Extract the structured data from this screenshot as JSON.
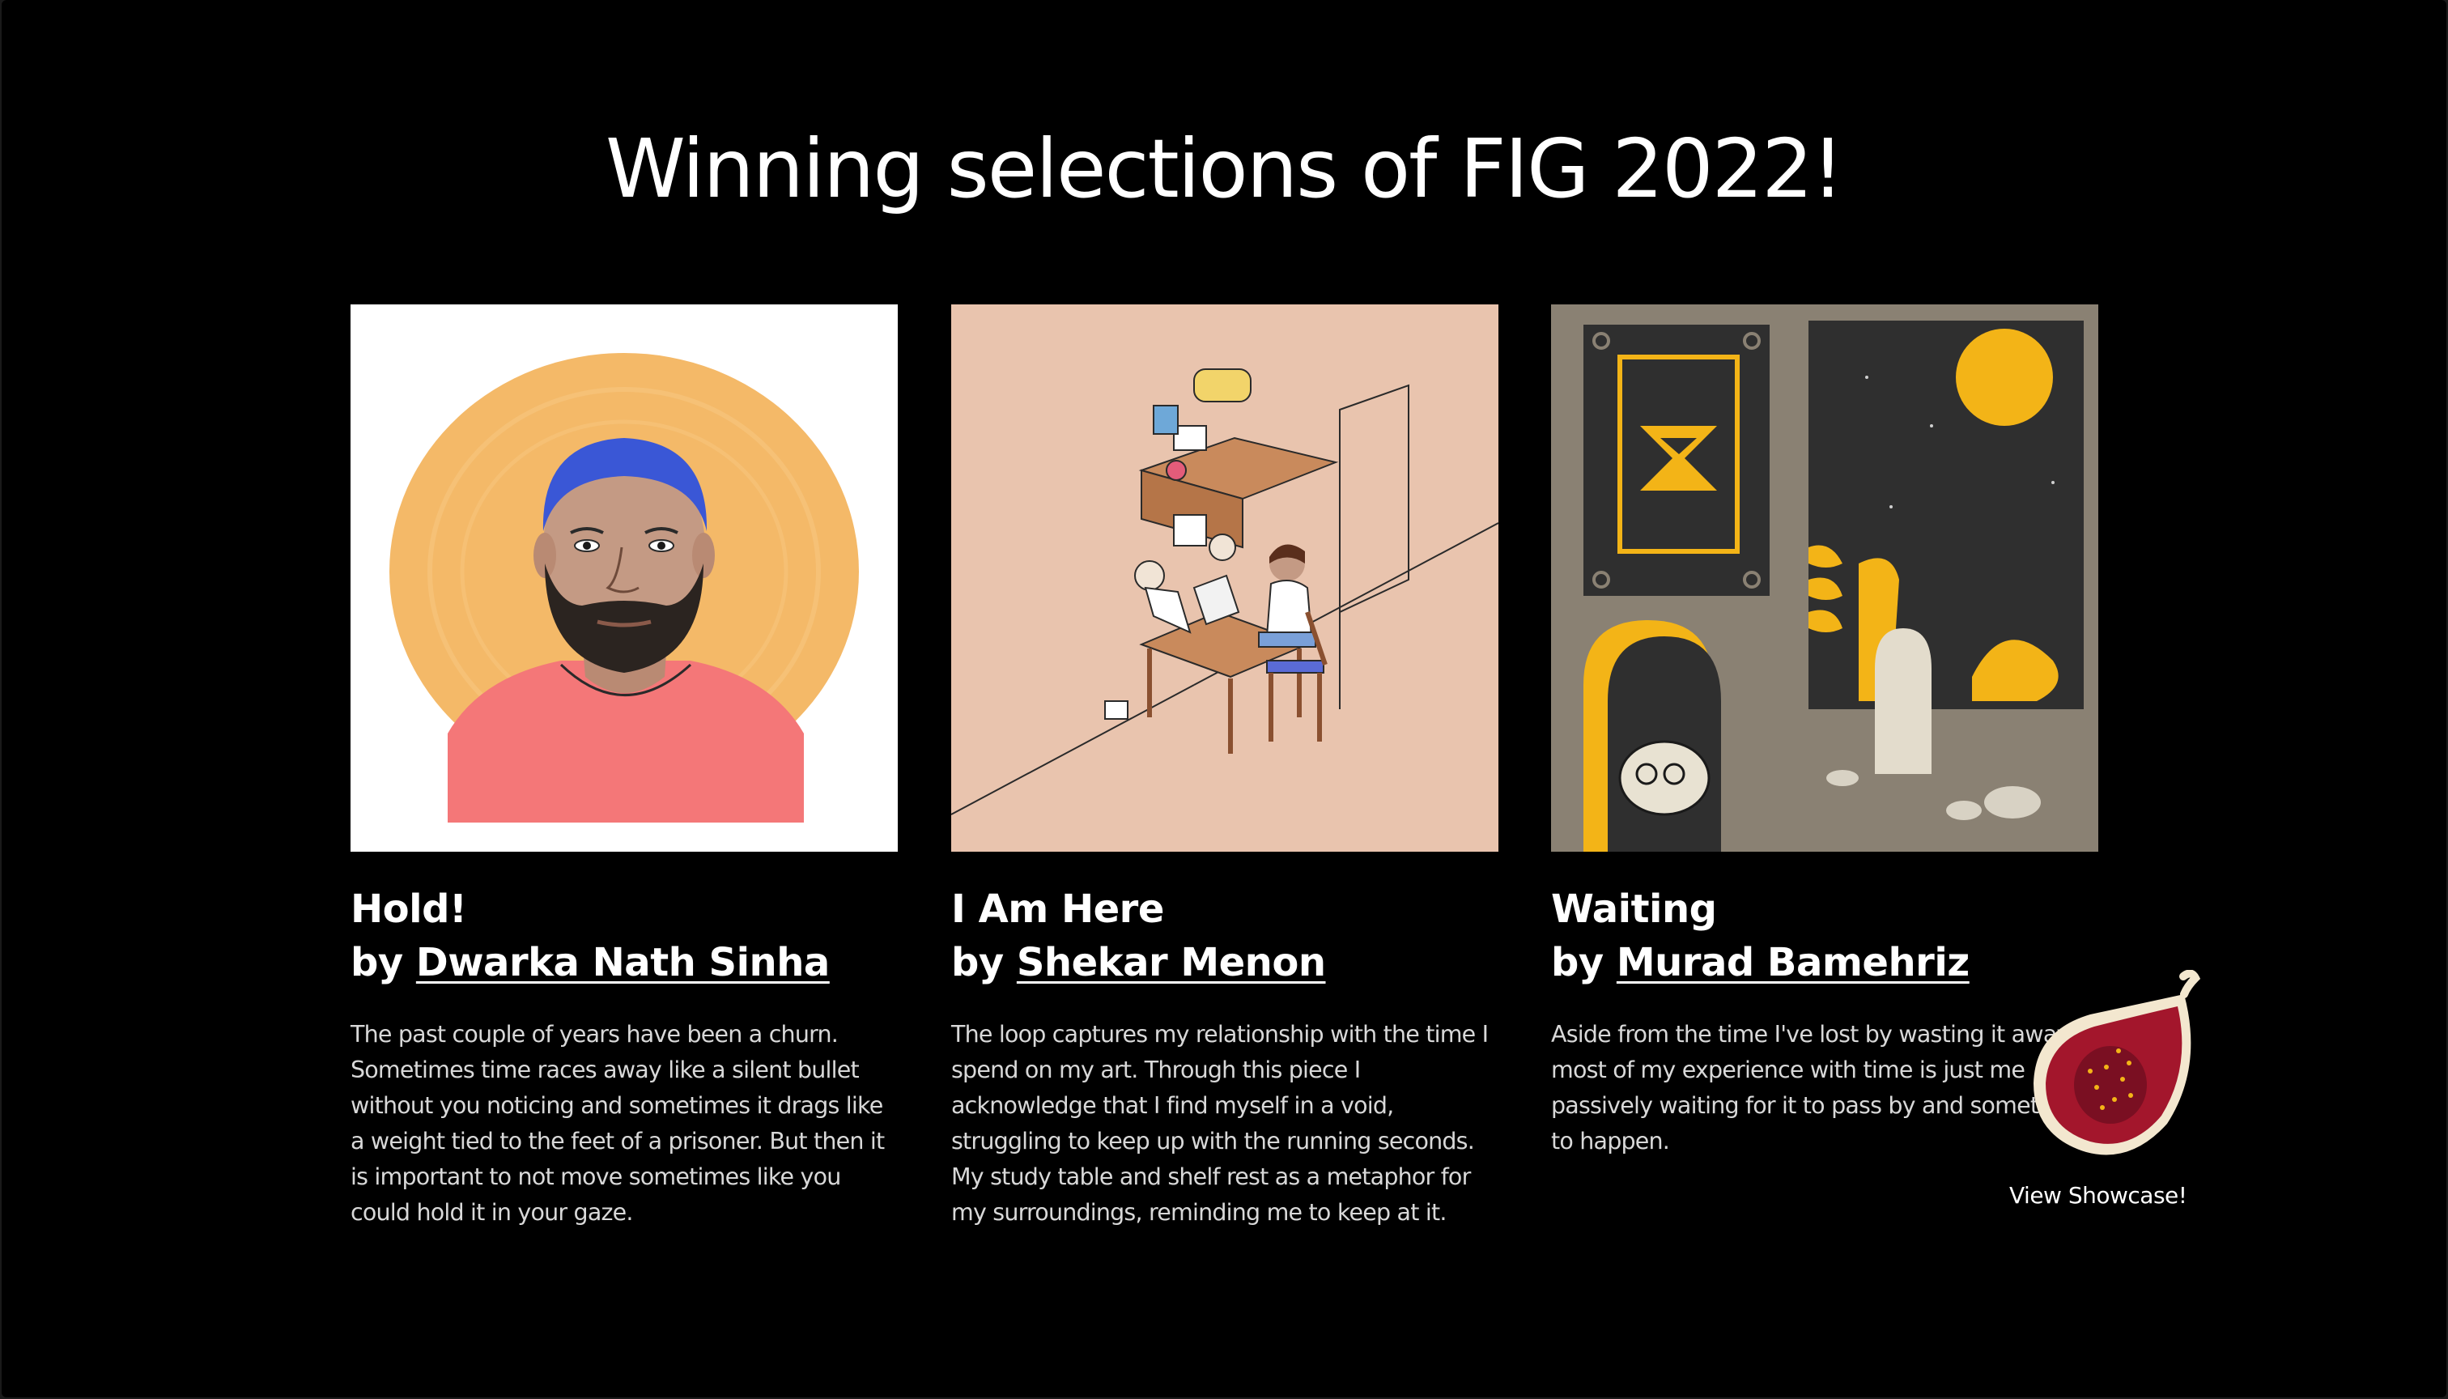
{
  "page": {
    "title": "Winning selections of FIG 2022!"
  },
  "cards": [
    {
      "title": "Hold!",
      "by": "by",
      "artist": "Dwarka Nath Sinha",
      "description": "The past couple of years have been a churn. Sometimes time races away like a silent bullet without you noticing and sometimes it drags like a weight tied to the feet of a prisoner. But then it is important to not move sometimes like you could hold it in your gaze.",
      "image": "portrait-illustration"
    },
    {
      "title": "I Am Here",
      "by": "by",
      "artist": "Shekar Menon",
      "description": "The loop captures my relationship with the time I spend on my art. Through this piece I acknowledge that I find myself in a void, struggling to keep up with the running seconds. My study table and shelf rest as a metaphor for my surroundings, reminding me to keep at it.",
      "image": "desk-illustration"
    },
    {
      "title": "Waiting",
      "by": "by",
      "artist": "Murad Bamehriz",
      "description": "Aside from the time I've lost by wasting it away, most of my experience with time is just me passively waiting for it to pass by and something to happen.",
      "image": "hourglass-illustration"
    }
  ],
  "showcase": {
    "label": "View Showcase!",
    "icon": "fig-fruit-icon"
  },
  "colors": {
    "background": "#000000",
    "text": "#ffffff",
    "muted_text": "#d8d8d8",
    "portrait_halo": "#f4b968",
    "portrait_shirt": "#f47778",
    "portrait_hair": "#3a57d6",
    "desk_bg": "#e9c4ae",
    "waiting_bg": "#8a8173",
    "waiting_accent": "#f3b417",
    "fig_flesh": "#a3162c"
  }
}
